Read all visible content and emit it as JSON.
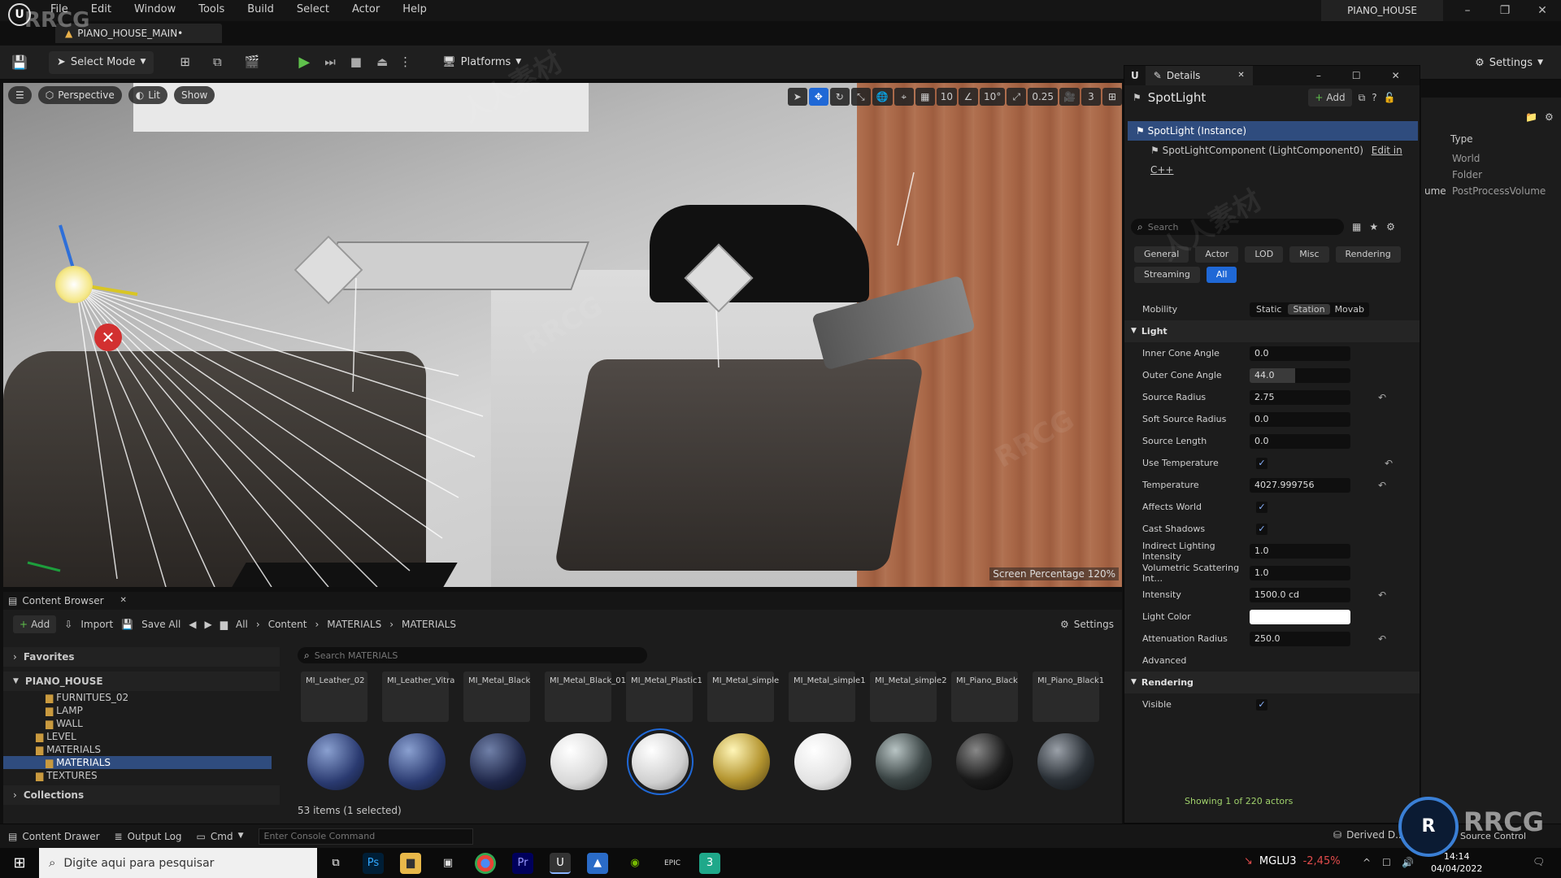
{
  "app": {
    "title": "PIANO_HOUSE",
    "document_tab": "PIANO_HOUSE_MAIN•"
  },
  "menu": [
    "File",
    "Edit",
    "Window",
    "Tools",
    "Build",
    "Select",
    "Actor",
    "Help"
  ],
  "window_controls": {
    "minimize": "–",
    "restore": "❐",
    "close": "✕"
  },
  "toolbar": {
    "select_mode": "Select Mode",
    "platforms": "Platforms",
    "settings": "Settings"
  },
  "viewport": {
    "perspective": "Perspective",
    "lit": "Lit",
    "show": "Show",
    "grid": "10",
    "rotation": "10°",
    "scale": "0.25",
    "camera_speed": "3",
    "screen_percentage": "Screen Percentage 120%"
  },
  "details": {
    "tab": "Details",
    "actor_name": "SpotLight",
    "add": "Add",
    "instance": "SpotLight (Instance)",
    "component": "SpotLightComponent (LightComponent0)",
    "edit_cpp": "Edit in C++",
    "search_placeholder": "Search",
    "categories": [
      "General",
      "Actor",
      "LOD",
      "Misc",
      "Rendering",
      "Streaming",
      "All"
    ],
    "mobility": {
      "label": "Mobility",
      "options": [
        "Static",
        "Station",
        "Movab"
      ]
    },
    "light_section": "Light",
    "props": [
      {
        "name": "Inner Cone Angle",
        "value": "0.0"
      },
      {
        "name": "Outer Cone Angle",
        "value": "44.0"
      },
      {
        "name": "Source Radius",
        "value": "2.75"
      },
      {
        "name": "Soft Source Radius",
        "value": "0.0"
      },
      {
        "name": "Source Length",
        "value": "0.0"
      },
      {
        "name": "Use Temperature",
        "value": "✓"
      },
      {
        "name": "Temperature",
        "value": "4027.999756"
      },
      {
        "name": "Affects World",
        "value": "✓"
      },
      {
        "name": "Cast Shadows",
        "value": "✓"
      },
      {
        "name": "Indirect Lighting Intensity",
        "value": "1.0"
      },
      {
        "name": "Volumetric Scattering Int...",
        "value": "1.0"
      },
      {
        "name": "Intensity",
        "value": "1500.0 cd"
      },
      {
        "name": "Light Color",
        "value": ""
      },
      {
        "name": "Attenuation Radius",
        "value": "250.0"
      }
    ],
    "advanced": "Advanced",
    "rendering_section": "Rendering",
    "visible": "Visible",
    "status": "Showing 1 of 220 actors"
  },
  "outliner": {
    "type_header": "Type",
    "rows": [
      {
        "name": "",
        "type": "World"
      },
      {
        "name": "",
        "type": "Folder"
      },
      {
        "name": "ume",
        "type": "PostProcessVolume"
      }
    ]
  },
  "content_browser": {
    "tab": "Content Browser",
    "add": "Add",
    "import": "Import",
    "save_all": "Save All",
    "breadcrumb": [
      "All",
      "Content",
      "MATERIALS",
      "MATERIALS"
    ],
    "settings": "Settings",
    "favorites": "Favorites",
    "project": "PIANO_HOUSE",
    "folders": [
      "FURNITUES_02",
      "LAMP",
      "WALL",
      "LEVEL",
      "MATERIALS",
      "MATERIALS",
      "TEXTURES"
    ],
    "collections": "Collections",
    "search_placeholder": "Search MATERIALS",
    "assets": [
      "MI_Leather_02",
      "MI_Leather_Vitra",
      "MI_Metal_Black",
      "MI_Metal_Black_01",
      "MI_Metal_Plastic1",
      "MI_Metal_simple",
      "MI_Metal_simple1",
      "MI_Metal_simple2",
      "MI_Piano_Black",
      "MI_Piano_Black1"
    ],
    "count": "53 items (1 selected)"
  },
  "statusbar": {
    "content_drawer": "Content Drawer",
    "output_log": "Output Log",
    "cmd": "Cmd",
    "console_placeholder": "Enter Console Command",
    "derived": "Derived D...",
    "source": "Source Control"
  },
  "taskbar": {
    "search_placeholder": "Digite aqui para pesquisar",
    "stock": "MGLU3",
    "stock_change": "-2,45%",
    "time": "14:14",
    "date": "04/04/2022"
  },
  "watermarks": [
    "RRCG",
    "人人素材",
    "RRCG",
    "RRCG",
    "人人素材",
    "RRCG"
  ]
}
